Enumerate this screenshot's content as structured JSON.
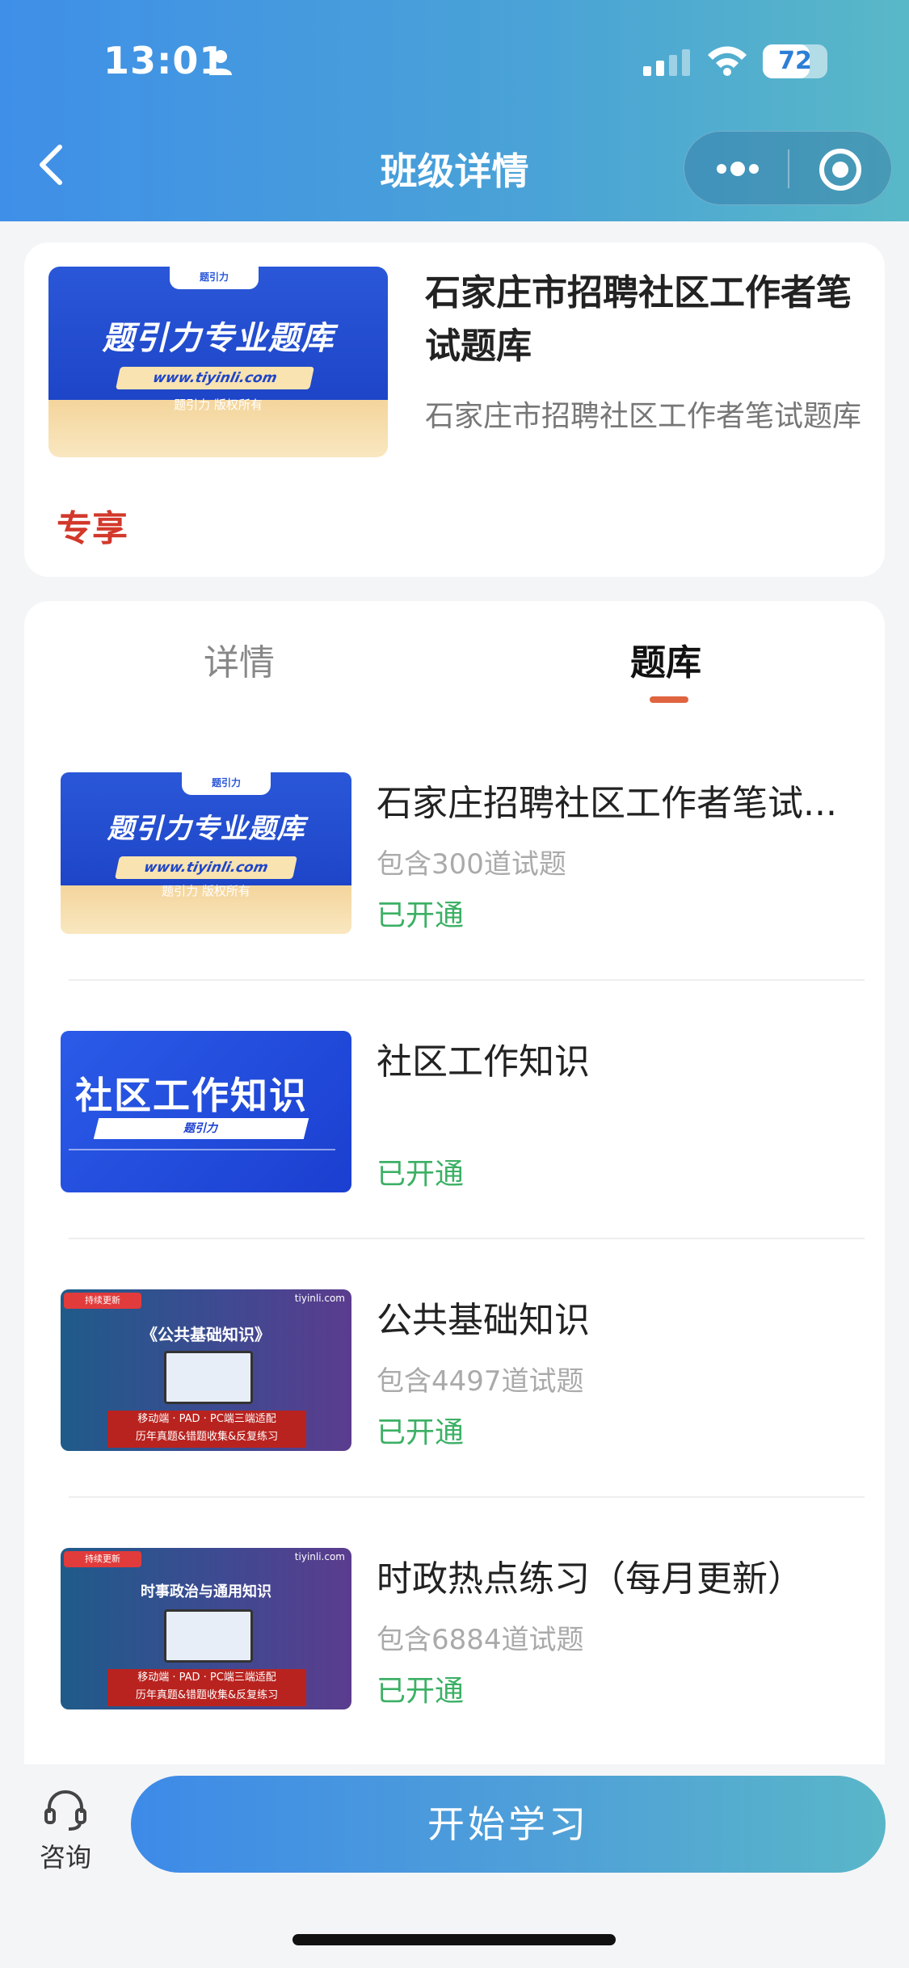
{
  "status_bar": {
    "time": "13:01",
    "battery": "72",
    "battery_level": 0.72
  },
  "header": {
    "title": "班级详情"
  },
  "course": {
    "title": "石家庄市招聘社区工作者笔试题库",
    "subtitle": "石家庄市招聘社区工作者笔试题库",
    "tag": "专享",
    "cover": {
      "logo": "题引力",
      "headline": "题引力专业题库",
      "url": "www.tiyinli.com",
      "copyright": "题引力 版权所有"
    }
  },
  "tabs": [
    {
      "label": "详情",
      "active": false
    },
    {
      "label": "题库",
      "active": true
    }
  ],
  "banks": [
    {
      "name": "石家庄招聘社区工作者笔试...",
      "count": "包含300道试题",
      "status": "已开通",
      "cover": {
        "logo": "题引力",
        "headline": "题引力专业题库",
        "url": "www.tiyinli.com",
        "copyright": "题引力 版权所有"
      }
    },
    {
      "name": "社区工作知识",
      "count": "",
      "status": "已开通",
      "cover": {
        "headline": "社区工作知识",
        "sub": "题引力"
      }
    },
    {
      "name": "公共基础知识",
      "count": "包含4497道试题",
      "status": "已开通",
      "cover": {
        "badge": "持续更新",
        "site": "tiyinli.com",
        "headline": "《公共基础知识》",
        "features": "移动端 · PAD · PC端三端适配",
        "features2": "历年真题&错题收集&反复练习"
      }
    },
    {
      "name": "时政热点练习（每月更新）",
      "count": "包含6884道试题",
      "status": "已开通",
      "cover": {
        "badge": "持续更新",
        "site": "tiyinli.com",
        "headline": "时事政治与通用知识",
        "features": "移动端 · PAD · PC端三端适配",
        "features2": "历年真题&错题收集&反复练习"
      }
    }
  ],
  "bottom": {
    "consult_label": "咨询",
    "start_label": "开始学习"
  },
  "colors": {
    "accent_blue": "#3f8fe8",
    "status_green": "#3cb065",
    "exclusive_red": "#d2382b",
    "tab_underline": "#e0643f"
  },
  "icons": [
    "person-icon",
    "signal-icon",
    "wifi-icon",
    "back-icon",
    "more-icon",
    "target-icon",
    "headset-icon"
  ]
}
